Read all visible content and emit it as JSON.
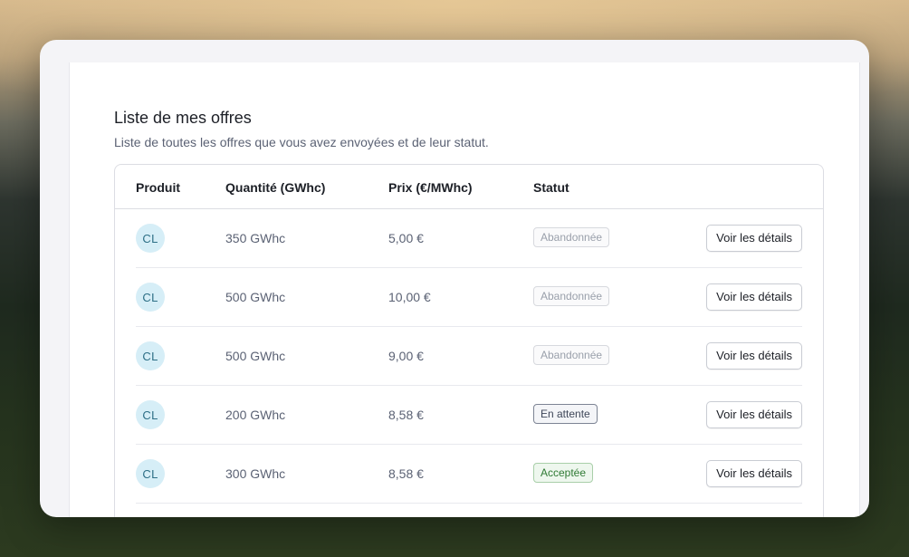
{
  "page": {
    "title": "Liste de mes offres",
    "subtitle": "Liste de toutes les offres que vous avez envoyées et de leur statut."
  },
  "table": {
    "headers": {
      "product": "Produit",
      "quantity": "Quantité (GWhc)",
      "price": "Prix (€/MWhc)",
      "status": "Statut"
    },
    "rows": [
      {
        "product": "CL",
        "quantity": "350 GWhc",
        "price": "5,00 €",
        "status": "Abandonnée",
        "action": "Voir les détails"
      },
      {
        "product": "CL",
        "quantity": "500 GWhc",
        "price": "10,00 €",
        "status": "Abandonnée",
        "action": "Voir les détails"
      },
      {
        "product": "CL",
        "quantity": "500 GWhc",
        "price": "9,00 €",
        "status": "Abandonnée",
        "action": "Voir les détails"
      },
      {
        "product": "CL",
        "quantity": "200 GWhc",
        "price": "8,58 €",
        "status": "En attente",
        "action": "Voir les détails"
      },
      {
        "product": "CL",
        "quantity": "300 GWhc",
        "price": "8,58 €",
        "status": "Acceptée",
        "action": "Voir les détails"
      }
    ]
  },
  "colors": {
    "avatar_bg": "#d6eef7",
    "status_abandoned": "#9aa0ab",
    "status_pending": "#3f4759",
    "status_accepted": "#2f7a34"
  }
}
